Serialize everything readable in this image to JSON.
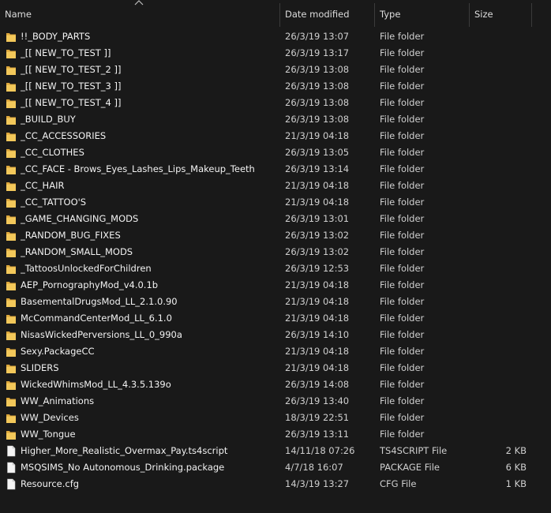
{
  "columns": {
    "name": "Name",
    "date": "Date modified",
    "type": "Type",
    "size": "Size"
  },
  "sort": {
    "column": "name",
    "direction": "ascending",
    "icon": "sort-up-icon"
  },
  "colors": {
    "background": "#191919",
    "folder": "#f3c85a",
    "folder_dark": "#dba53a",
    "file": "#f4f4f4"
  },
  "files": [
    {
      "name": "!!_BODY_PARTS",
      "date": "26/3/19 13:07",
      "type": "File folder",
      "size": "",
      "icon": "folder-icon"
    },
    {
      "name": "_[[ NEW_TO_TEST ]]",
      "date": "26/3/19 13:17",
      "type": "File folder",
      "size": "",
      "icon": "folder-icon"
    },
    {
      "name": "_[[ NEW_TO_TEST_2 ]]",
      "date": "26/3/19 13:08",
      "type": "File folder",
      "size": "",
      "icon": "folder-icon"
    },
    {
      "name": "_[[ NEW_TO_TEST_3 ]]",
      "date": "26/3/19 13:08",
      "type": "File folder",
      "size": "",
      "icon": "folder-icon"
    },
    {
      "name": "_[[ NEW_TO_TEST_4 ]]",
      "date": "26/3/19 13:08",
      "type": "File folder",
      "size": "",
      "icon": "folder-icon"
    },
    {
      "name": "_BUILD_BUY",
      "date": "26/3/19 13:08",
      "type": "File folder",
      "size": "",
      "icon": "folder-icon"
    },
    {
      "name": "_CC_ACCESSORIES",
      "date": "21/3/19 04:18",
      "type": "File folder",
      "size": "",
      "icon": "folder-icon"
    },
    {
      "name": "_CC_CLOTHES",
      "date": "26/3/19 13:05",
      "type": "File folder",
      "size": "",
      "icon": "folder-icon"
    },
    {
      "name": "_CC_FACE - Brows_Eyes_Lashes_Lips_Makeup_Teeth",
      "date": "26/3/19 13:14",
      "type": "File folder",
      "size": "",
      "icon": "folder-icon"
    },
    {
      "name": "_CC_HAIR",
      "date": "21/3/19 04:18",
      "type": "File folder",
      "size": "",
      "icon": "folder-icon"
    },
    {
      "name": "_CC_TATTOO'S",
      "date": "21/3/19 04:18",
      "type": "File folder",
      "size": "",
      "icon": "folder-icon"
    },
    {
      "name": "_GAME_CHANGING_MODS",
      "date": "26/3/19 13:01",
      "type": "File folder",
      "size": "",
      "icon": "folder-icon"
    },
    {
      "name": "_RANDOM_BUG_FIXES",
      "date": "26/3/19 13:02",
      "type": "File folder",
      "size": "",
      "icon": "folder-icon"
    },
    {
      "name": "_RANDOM_SMALL_MODS",
      "date": "26/3/19 13:02",
      "type": "File folder",
      "size": "",
      "icon": "folder-icon"
    },
    {
      "name": "_TattoosUnlockedForChildren",
      "date": "26/3/19 12:53",
      "type": "File folder",
      "size": "",
      "icon": "folder-icon"
    },
    {
      "name": "AEP_PornographyMod_v4.0.1b",
      "date": "21/3/19 04:18",
      "type": "File folder",
      "size": "",
      "icon": "folder-icon"
    },
    {
      "name": "BasementalDrugsMod_LL_2.1.0.90",
      "date": "21/3/19 04:18",
      "type": "File folder",
      "size": "",
      "icon": "folder-icon"
    },
    {
      "name": "McCommandCenterMod_LL_6.1.0",
      "date": "21/3/19 04:18",
      "type": "File folder",
      "size": "",
      "icon": "folder-icon"
    },
    {
      "name": "NisasWickedPerversions_LL_0_990a",
      "date": "26/3/19 14:10",
      "type": "File folder",
      "size": "",
      "icon": "folder-icon"
    },
    {
      "name": "Sexy.PackageCC",
      "date": "21/3/19 04:18",
      "type": "File folder",
      "size": "",
      "icon": "folder-icon"
    },
    {
      "name": "SLIDERS",
      "date": "21/3/19 04:18",
      "type": "File folder",
      "size": "",
      "icon": "folder-icon"
    },
    {
      "name": "WickedWhimsMod_LL_4.3.5.139o",
      "date": "26/3/19 14:08",
      "type": "File folder",
      "size": "",
      "icon": "folder-icon"
    },
    {
      "name": "WW_Animations",
      "date": "26/3/19 13:40",
      "type": "File folder",
      "size": "",
      "icon": "folder-icon"
    },
    {
      "name": "WW_Devices",
      "date": "18/3/19 22:51",
      "type": "File folder",
      "size": "",
      "icon": "folder-icon"
    },
    {
      "name": "WW_Tongue",
      "date": "26/3/19 13:11",
      "type": "File folder",
      "size": "",
      "icon": "folder-icon"
    },
    {
      "name": "Higher_More_Realistic_Overmax_Pay.ts4script",
      "date": "14/11/18 07:26",
      "type": "TS4SCRIPT File",
      "size": "2 KB",
      "icon": "file-icon"
    },
    {
      "name": "MSQSIMS_No Autonomous_Drinking.package",
      "date": "4/7/18 16:07",
      "type": "PACKAGE File",
      "size": "6 KB",
      "icon": "file-icon"
    },
    {
      "name": "Resource.cfg",
      "date": "14/3/19 13:27",
      "type": "CFG File",
      "size": "1 KB",
      "icon": "file-icon"
    }
  ]
}
